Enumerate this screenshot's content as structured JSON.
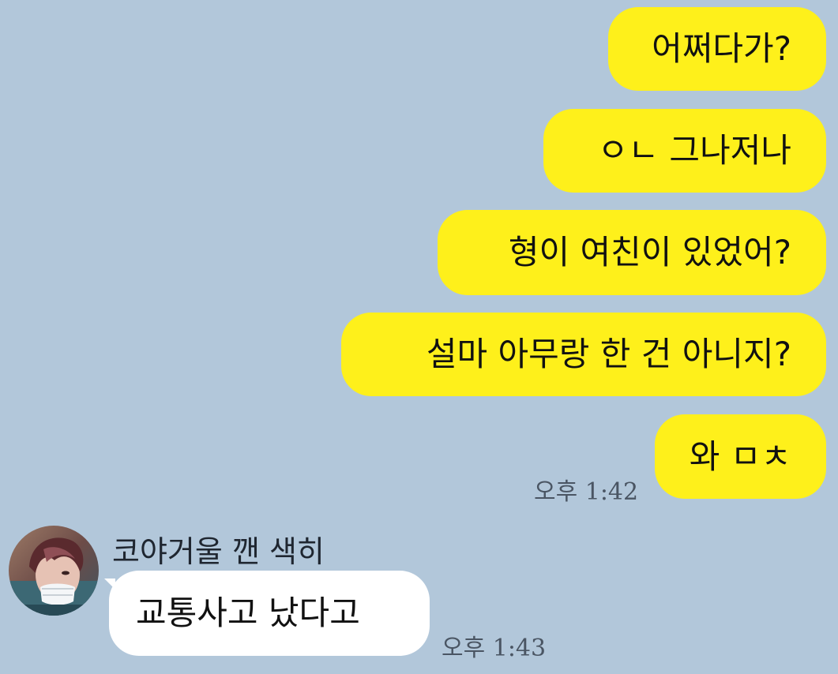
{
  "conversation": {
    "sent_messages": [
      {
        "text": "어쩌다가?"
      },
      {
        "text": "ㅇㄴ 그나저나"
      },
      {
        "text": "형이 여친이 있었어?"
      },
      {
        "text": "설마 아무랑 한 건 아니지?"
      },
      {
        "text": "와 ㅁㅊ"
      }
    ],
    "sent_time": "오후 1:42",
    "received": {
      "sender_name": "코야거울 깬 색히",
      "text": "교통사고 났다고",
      "time": "오후 1:43"
    }
  },
  "colors": {
    "background": "#b2c7da",
    "my_bubble": "#fef01b",
    "their_bubble": "#ffffff"
  },
  "icons": {
    "avatar": "profile-photo"
  }
}
